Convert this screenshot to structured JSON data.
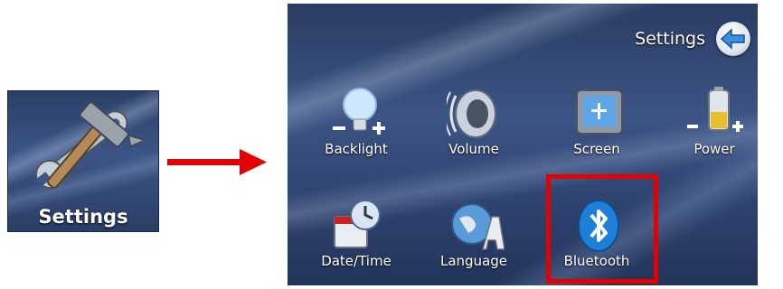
{
  "tile": {
    "label": "Settings"
  },
  "panel": {
    "title": "Settings",
    "items": [
      {
        "label": "Backlight"
      },
      {
        "label": "Volume"
      },
      {
        "label": "Screen"
      },
      {
        "label": "Power"
      },
      {
        "label": "Date/Time"
      },
      {
        "label": "Language"
      },
      {
        "label": "Bluetooth"
      }
    ]
  },
  "colors": {
    "highlight": "#e40000",
    "arrow": "#e40000",
    "panel_bg": "#3c5484"
  }
}
